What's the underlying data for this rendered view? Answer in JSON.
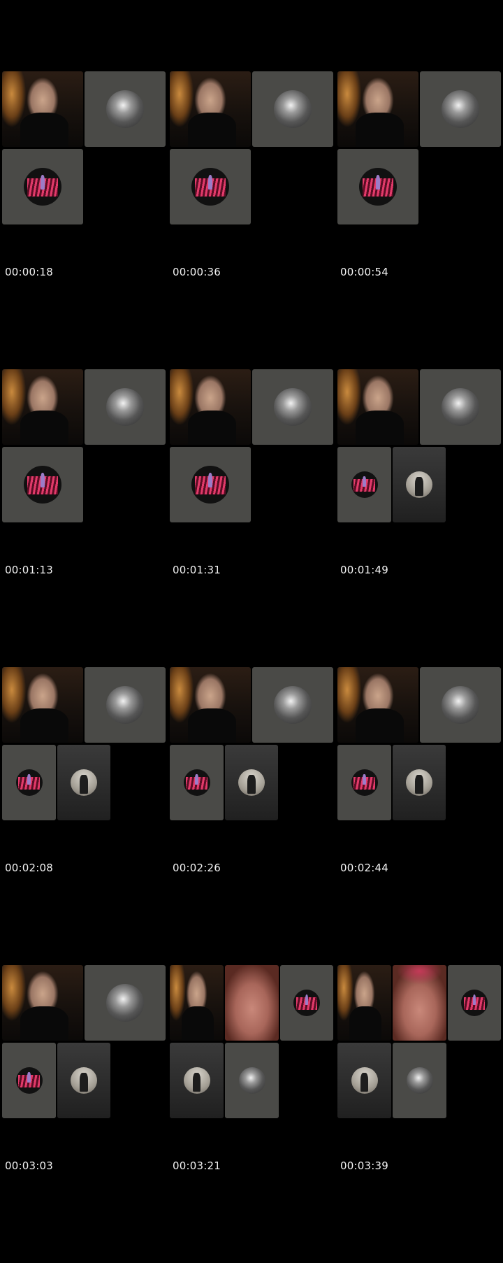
{
  "frames": [
    {
      "timestamp": "00:00:18"
    },
    {
      "timestamp": "00:00:36"
    },
    {
      "timestamp": "00:00:54"
    },
    {
      "timestamp": "00:01:13"
    },
    {
      "timestamp": "00:01:31"
    },
    {
      "timestamp": "00:01:49"
    },
    {
      "timestamp": "00:02:08"
    },
    {
      "timestamp": "00:02:26"
    },
    {
      "timestamp": "00:02:44"
    },
    {
      "timestamp": "00:03:03"
    },
    {
      "timestamp": "00:03:21"
    },
    {
      "timestamp": "00:03:39"
    }
  ]
}
